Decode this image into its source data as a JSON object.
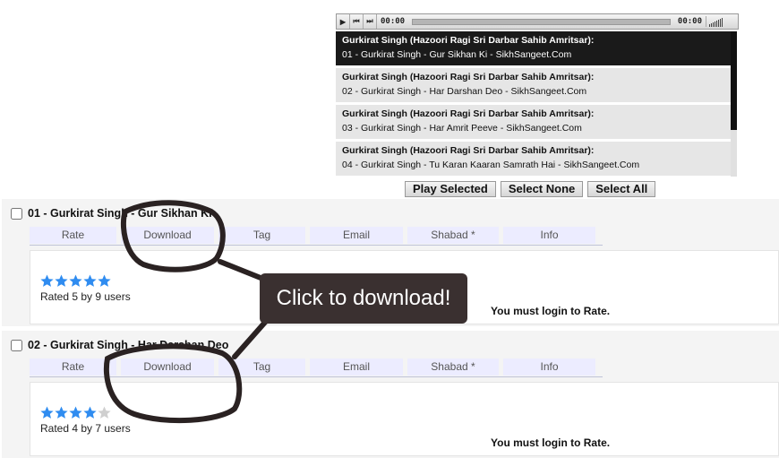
{
  "player": {
    "time_elapsed": "00:00",
    "time_total": "00:00",
    "icons": [
      "play-icon",
      "previous-icon",
      "next-icon",
      "volume-icon"
    ]
  },
  "playlist": [
    {
      "artist": "Gurkirat Singh (Hazoori Ragi Sri Darbar Sahib Amritsar):",
      "track": "01 - Gurkirat Singh - Gur Sikhan Ki - SikhSangeet.Com",
      "active": true
    },
    {
      "artist": "Gurkirat Singh (Hazoori Ragi Sri Darbar Sahib Amritsar):",
      "track": "02 - Gurkirat Singh - Har Darshan Deo - SikhSangeet.Com",
      "active": false
    },
    {
      "artist": "Gurkirat Singh (Hazoori Ragi Sri Darbar Sahib Amritsar):",
      "track": "03 - Gurkirat Singh - Har Amrit Peeve - SikhSangeet.Com",
      "active": false
    },
    {
      "artist": "Gurkirat Singh (Hazoori Ragi Sri Darbar Sahib Amritsar):",
      "track": "04 - Gurkirat Singh - Tu Karan Kaaran Samrath Hai - SikhSangeet.Com",
      "active": false
    }
  ],
  "playlist_buttons": {
    "play_selected": "Play Selected",
    "select_none": "Select None",
    "select_all": "Select All"
  },
  "tabs": [
    "Rate",
    "Download",
    "Tag",
    "Email",
    "Shabad *",
    "Info"
  ],
  "tracks": [
    {
      "title": "01 - Gurkirat Singh - Gur Sikhan Ki",
      "rating": 5,
      "rating_text": "Rated 5 by 9 users",
      "login_text": "You must login to Rate."
    },
    {
      "title": "02 - Gurkirat Singh - Har Darshan Deo",
      "rating": 4,
      "rating_text": "Rated 4 by 7 users",
      "login_text": "You must login to Rate."
    }
  ],
  "annotation": {
    "callout_text": "Click to download!"
  },
  "colors": {
    "star_filled": "#2f8cf0",
    "star_empty": "#cfcfcf",
    "tab_bg": "#ececff",
    "active_playlist_bg": "#1a1a1a",
    "callout_bg": "#3a3030"
  }
}
